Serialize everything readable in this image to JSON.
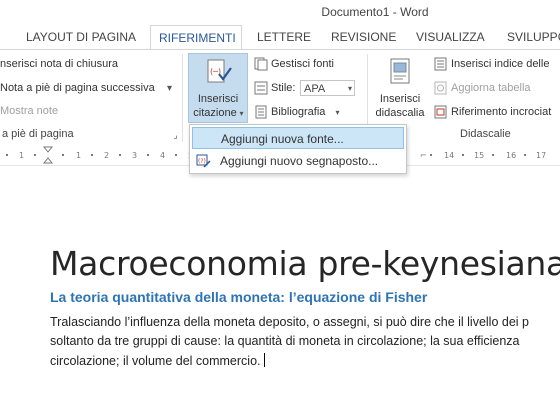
{
  "window": {
    "title": "Documento1 - Word"
  },
  "tabs": [
    {
      "label": "LAYOUT DI PAGINA",
      "active": false
    },
    {
      "label": "RIFERIMENTI",
      "active": true
    },
    {
      "label": "LETTERE",
      "active": false
    },
    {
      "label": "REVISIONE",
      "active": false
    },
    {
      "label": "VISUALIZZA",
      "active": false
    },
    {
      "label": "SVILUPPO",
      "active": false
    }
  ],
  "ribbon": {
    "footnotes": {
      "insert_endnote": "nserisci nota di chiusura",
      "next_footnote": "Nota a piè di pagina successiva",
      "show_notes": "Mostra note",
      "group_label": "a piè di pagina"
    },
    "citations": {
      "insert_citation_line1": "Inserisci",
      "insert_citation_line2": "citazione",
      "manage_sources": "Gestisci fonti",
      "style_label": "Stile:",
      "style_value": "APA",
      "bibliography": "Bibliografia"
    },
    "captions": {
      "insert_caption_line1": "Inserisci",
      "insert_caption_line2": "didascalia",
      "insert_table_of_figures": "Inserisci indice delle",
      "update_table": "Aggiorna tabella",
      "cross_reference": "Riferimento incrociat",
      "group_label": "Didascalie"
    }
  },
  "dropdown": {
    "items": [
      {
        "label": "Aggiungi nuova fonte...",
        "icon": "add-source-icon"
      },
      {
        "label": "Aggiungi nuovo segnaposto...",
        "icon": "add-placeholder-icon"
      }
    ]
  },
  "document": {
    "title": "Macroeconomia pre-keynesiana",
    "subtitle": "La teoria quantitativa della moneta: l’equazione di Fisher",
    "body_lines": [
      "Tralasciando l’influenza della moneta deposito, o assegni, si può dire che il livello dei p",
      "soltanto da tre gruppi di cause: la quantità di moneta in circolazione; la sua efficienza",
      "circolazione; il volume del commercio."
    ]
  },
  "colors": {
    "accent": "#2b579a",
    "heading2": "#2e74b5",
    "selected_button": "#c5dcef",
    "menu_hover": "#cde6f7"
  }
}
